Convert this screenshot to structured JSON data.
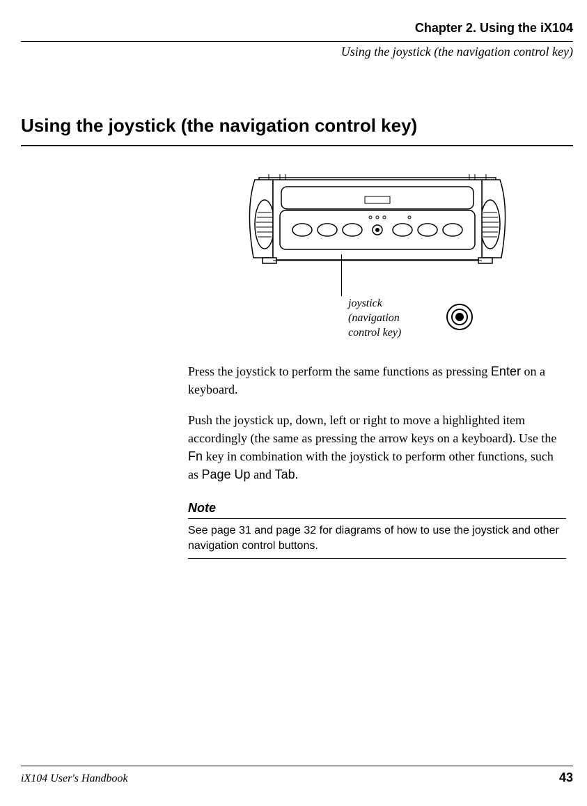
{
  "header": {
    "chapter": "Chapter 2. Using the iX104",
    "section": "Using the joystick (the navigation control key)"
  },
  "heading": "Using the joystick (the navigation control key)",
  "figure": {
    "callout_line1": "joystick",
    "callout_line2": "(navigation",
    "callout_line3": "control key)"
  },
  "body": {
    "p1_a": "Press the joystick to perform the same functions as pressing ",
    "p1_key": "Enter",
    "p1_b": " on a keyboard.",
    "p2_a": "Push the joystick up, down, left or right to move a highlighted item accordingly (the same as pressing the arrow keys on a keyboard). Use the ",
    "p2_key1": "Fn",
    "p2_b": " key in combination with the joystick to perform other functions, such as ",
    "p2_key2": "Page Up",
    "p2_c": " and ",
    "p2_key3": "Tab",
    "p2_d": "."
  },
  "note": {
    "heading": "Note",
    "text": "See page 31 and page 32 for diagrams of how to use the joystick and other navigation control buttons."
  },
  "footer": {
    "book": "iX104 User's Handbook",
    "page": "43"
  }
}
